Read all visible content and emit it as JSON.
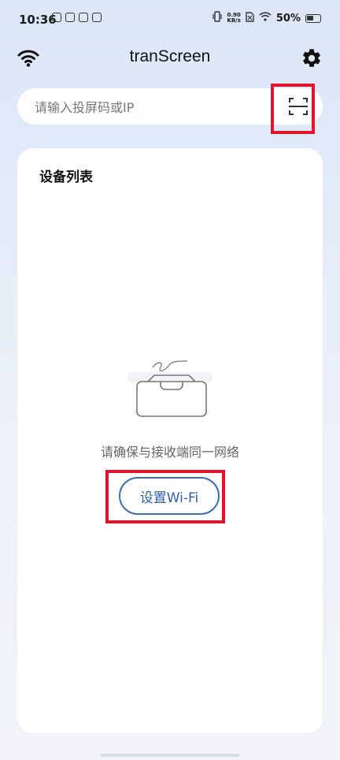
{
  "status_bar": {
    "time": "10:36",
    "net_speed_value": "0.90",
    "net_speed_unit": "KB/s",
    "battery": "50%"
  },
  "app_bar": {
    "title": "tranScreen",
    "left_icon": "wifi-icon",
    "right_icon": "gear-icon"
  },
  "search": {
    "placeholder": "请输入投屏码或IP",
    "value": "",
    "scan_icon": "scan-icon"
  },
  "devices": {
    "title": "设备列表",
    "empty_message": "请确保与接收端同一网络",
    "setup_wifi_label": "设置Wi-Fi",
    "items": []
  },
  "colors": {
    "accent": "#3b6fb1",
    "highlight": "#e0142c",
    "background_top": "#dbe6f7"
  }
}
